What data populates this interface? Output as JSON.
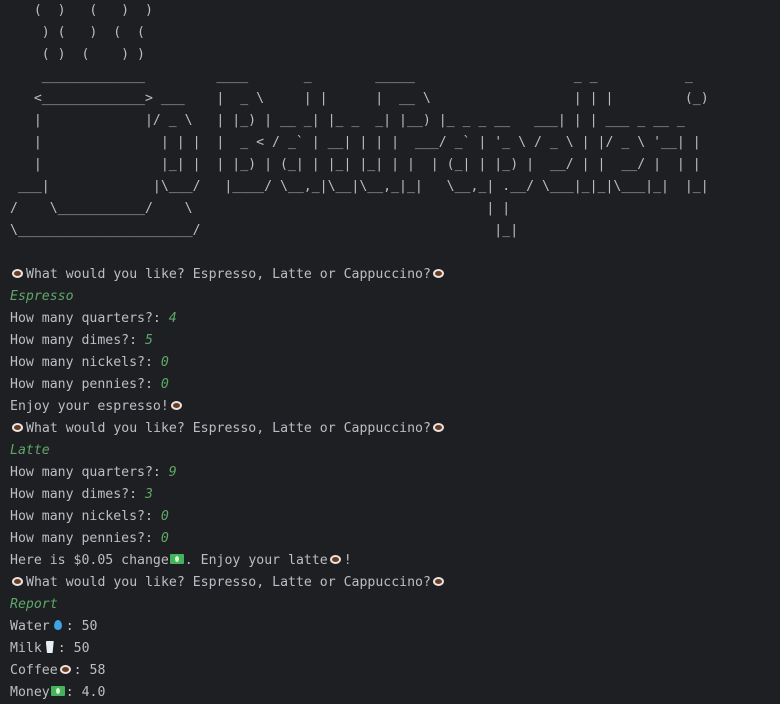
{
  "ascii_art": [
    "   (  )   (   )  )",
    "    ) (   )  (  (",
    "    ( )  (    ) )",
    "    _____________         ____       _        _____                    _ _           _",
    "   <_____________> ___    |  _ \\     | |      |  __ \\                  | | |         (_)",
    "   |             |/ _ \\   | |_) | __ _| |_ _  _| |__) |_ _ _ __   ___| | | ___ _ __ _",
    "   |               | | |  |  _ < / _` | __| | | |  ___/ _` | '_ \\ / _ \\ | |/ _ \\ '__| |",
    "   |               |_| |  | |_) | (_| | |_| |_| | |  | (_| | |_) |  __/ | |  __/ |  | |",
    " ___|             |\\___/   |____/ \\__,_|\\__|\\__,_|_|   \\__,_| .__/ \\___|_|_|\\___|_|  |_|",
    "/    \\___________/    \\                                     | |",
    "\\______________________/                                     |_|"
  ],
  "icons": {
    "coffee": "coffee-icon",
    "droplet": "droplet-icon",
    "milk": "milk-icon",
    "money": "money-icon"
  },
  "colors": {
    "background": "#1e1f22",
    "text": "#bcbec4",
    "input": "#5fa768"
  },
  "session": {
    "prompt_text": "What would you like? Espresso, Latte or Cappuccino?",
    "order1": {
      "choice": "Espresso",
      "q_quarters": "How many quarters?: ",
      "a_quarters": "4",
      "q_dimes": "How many dimes?: ",
      "a_dimes": "5",
      "q_nickels": "How many nickels?: ",
      "a_nickels": "0",
      "q_pennies": "How many pennies?: ",
      "a_pennies": "0",
      "result": "Enjoy your espresso!"
    },
    "order2": {
      "choice": "Latte",
      "q_quarters": "How many quarters?: ",
      "a_quarters": "9",
      "q_dimes": "How many dimes?: ",
      "a_dimes": "3",
      "q_nickels": "How many nickels?: ",
      "a_nickels": "0",
      "q_pennies": "How many pennies?: ",
      "a_pennies": "0",
      "change_prefix": "Here is $0.05 change",
      "change_middle": ". Enjoy your latte",
      "change_suffix": "!"
    },
    "order3": {
      "choice": "Report"
    },
    "report": {
      "water_label": "Water",
      "water_value": ": 50",
      "milk_label": "Milk",
      "milk_value": ": 50",
      "coffee_label": "Coffee",
      "coffee_value": ": 58",
      "money_label": "Money",
      "money_value": ": 4.0"
    }
  }
}
